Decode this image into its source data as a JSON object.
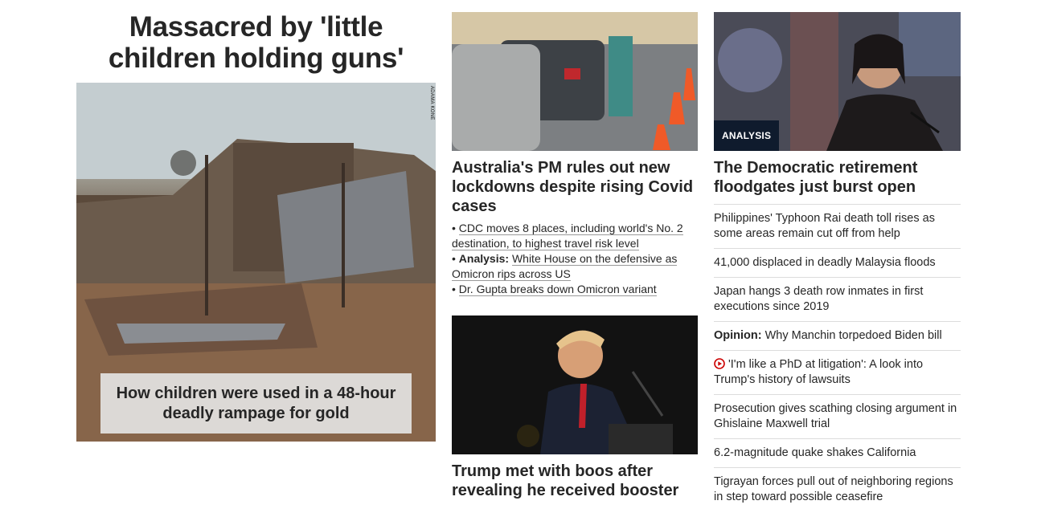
{
  "lead": {
    "headline": "Massacred by 'little children holding guns'",
    "photo_credit": "ADAMA KONE",
    "caption": "How children were used in a 48-hour deadly rampage for gold"
  },
  "middle": {
    "story1": {
      "headline": "Australia's PM rules out new lockdowns despite rising Covid cases",
      "bullets": [
        {
          "text": "CDC moves 8 places, including world's No. 2 destination, to highest travel risk level"
        },
        {
          "prefix": "Analysis:",
          "text": "White House on the defensive as Omicron rips across US"
        },
        {
          "text": "Dr. Gupta breaks down Omicron variant"
        }
      ]
    },
    "story2": {
      "headline": "Trump met with boos after revealing he received booster"
    }
  },
  "right": {
    "badge": "ANALYSIS",
    "headline": "The Democratic retirement floodgates just burst open",
    "items": [
      {
        "text": "Philippines' Typhoon Rai death toll rises as some areas remain cut off from help"
      },
      {
        "text": "41,000 displaced in deadly Malaysia floods"
      },
      {
        "text": "Japan hangs 3 death row inmates in first executions since 2019"
      },
      {
        "prefix": "Opinion:",
        "text": "Why Manchin torpedoed Biden bill"
      },
      {
        "icon": "video-play-icon",
        "text": "'I'm like a PhD at litigation': A look into Trump's history of lawsuits"
      },
      {
        "text": "Prosecution gives scathing closing argument in Ghislaine Maxwell trial"
      },
      {
        "text": "6.2-magnitude quake shakes California"
      },
      {
        "text": "Tigrayan forces pull out of neighboring regions in step toward possible ceasefire"
      }
    ]
  },
  "colors": {
    "text": "#262626",
    "badge_bg": "#0f1b2d",
    "video_icon": "#cc0000",
    "divider": "#dcdcdc"
  }
}
